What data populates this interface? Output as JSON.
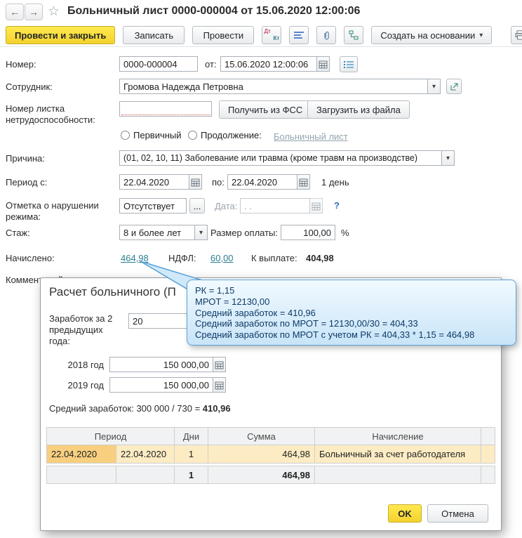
{
  "colors": {
    "accent_yellow": "#f4d22e",
    "link": "#2e7f92",
    "tooltip_border": "#58a0d6",
    "highlight_row": "#fdecc3",
    "selected_cell": "#f7cf7f",
    "required_underline": "#e05a4a"
  },
  "icons": {
    "back": "←",
    "forward": "→",
    "star": "☆",
    "caret": "▾",
    "ellipsis": "..."
  },
  "header": {
    "title": "Больничный лист 0000-000004 от 15.06.2020 12:00:06"
  },
  "toolbar": {
    "post_and_close": "Провести и закрыть",
    "write": "Записать",
    "post": "Провести",
    "dt": "Дт",
    "kt": "Кт",
    "create_based_on": "Создать на основании"
  },
  "form": {
    "number": {
      "label": "Номер:",
      "value": "0000-000004",
      "date_label": "от:",
      "date_value": "15.06.2020 12:00:06"
    },
    "employee": {
      "label": "Сотрудник:",
      "value": "Громова Надежда Петровна"
    },
    "sick_number": {
      "label": "Номер листка нетрудоспособности:",
      "value": "",
      "get_fss": "Получить из ФСС",
      "load_file": "Загрузить из файла"
    },
    "doc_type": {
      "primary": "Первичный",
      "continuation": "Продолжение:",
      "link": "Больничный лист"
    },
    "reason": {
      "label": "Причина:",
      "value": "(01, 02, 10, 11) Заболевание или травма (кроме травм на производстве)"
    },
    "period": {
      "label": "Период с:",
      "from": "22.04.2020",
      "to_label": "по:",
      "to": "22.04.2020",
      "days": "1 день"
    },
    "violation": {
      "label": "Отметка о нарушении режима:",
      "value": "Отсутствует",
      "date_label": "Дата:",
      "date_placeholder": ". .",
      "help": "?"
    },
    "experience": {
      "label": "Стаж:",
      "value": "8 и более лет",
      "pay_label": "Размер оплаты:",
      "pay_value": "100,00",
      "percent": "%"
    },
    "totals": {
      "label": "Начислено:",
      "accrued": "464,98",
      "ndfl_label": "НДФЛ:",
      "ndfl": "60,00",
      "payout_label": "К выплате:",
      "payout": "404,98"
    },
    "comment": {
      "label": "Комментарий:"
    }
  },
  "dialog": {
    "title": "Расчет больничного (П",
    "earnings_label": "Заработок за 2 предыдущих года:",
    "earnings_value": "20",
    "year2018": {
      "label": "2018 год",
      "value": "150 000,00"
    },
    "year2019": {
      "label": "2019 год",
      "value": "150 000,00"
    },
    "avg_prefix": "Средний заработок: 300 000 / 730 = ",
    "avg_value": "410,96",
    "table": {
      "headers": [
        "Период",
        "Дни",
        "Сумма",
        "Начисление"
      ],
      "row": {
        "from": "22.04.2020",
        "to": "22.04.2020",
        "days": "1",
        "sum": "464,98",
        "name": "Больничный за счет работодателя"
      },
      "total": {
        "days": "1",
        "sum": "464,98"
      }
    },
    "ok": "OK",
    "cancel": "Отмена"
  },
  "tooltip": {
    "lines": [
      "РК = 1,15",
      "МРОТ = 12130,00",
      "Средний заработок = 410,96",
      "Средний заработок по МРОТ = 12130,00/30 = 404,33",
      "Средний заработок по МРОТ с учетом РК = 404,33 * 1,15 = 464,98"
    ]
  }
}
